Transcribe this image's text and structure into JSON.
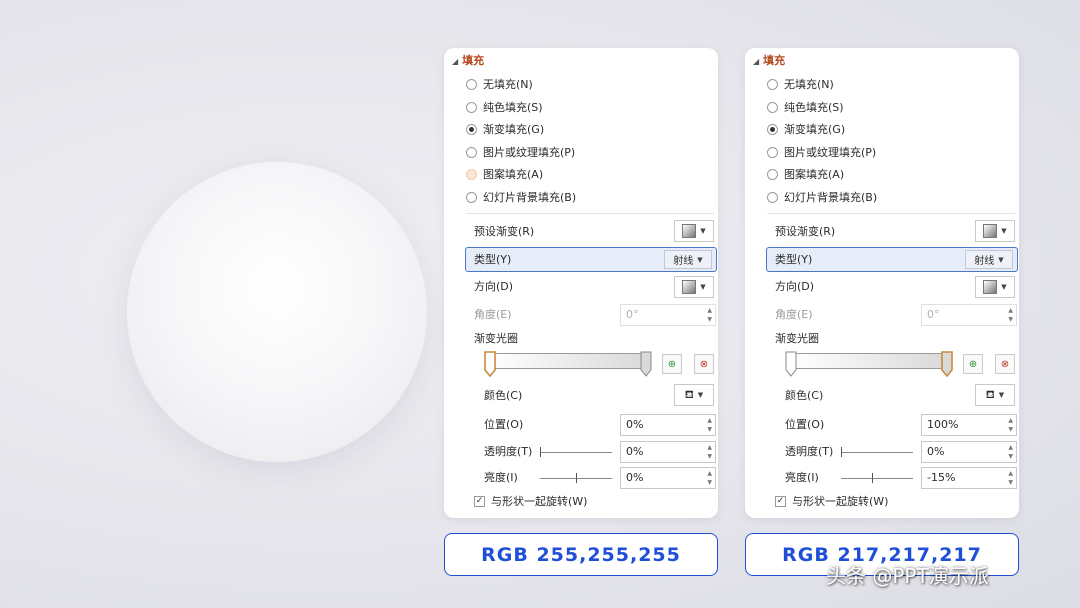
{
  "panels": [
    {
      "section_title": "填充",
      "fill_options": [
        {
          "label": "无填充(N)",
          "state": "unchecked"
        },
        {
          "label": "纯色填充(S)",
          "state": "unchecked"
        },
        {
          "label": "渐变填充(G)",
          "state": "checked"
        },
        {
          "label": "图片或纹理填充(P)",
          "state": "unchecked"
        },
        {
          "label": "图案填充(A)",
          "state": "hover"
        },
        {
          "label": "幻灯片背景填充(B)",
          "state": "unchecked"
        }
      ],
      "preset_label": "预设渐变(R)",
      "type_label": "类型(Y)",
      "type_value": "射线",
      "direction_label": "方向(D)",
      "angle_label": "角度(E)",
      "angle_value": "0°",
      "stops_label": "渐变光圈",
      "active_stop": "left",
      "color_label": "颜色(C)",
      "position_label": "位置(O)",
      "position_value": "0%",
      "transparency_label": "透明度(T)",
      "transparency_value": "0%",
      "brightness_label": "亮度(I)",
      "brightness_value": "0%",
      "rotate_label": "与形状一起旋转(W)",
      "rotate_checked": true,
      "rgb_text": "RGB 255,255,255"
    },
    {
      "section_title": "填充",
      "fill_options": [
        {
          "label": "无填充(N)",
          "state": "unchecked"
        },
        {
          "label": "纯色填充(S)",
          "state": "unchecked"
        },
        {
          "label": "渐变填充(G)",
          "state": "checked"
        },
        {
          "label": "图片或纹理填充(P)",
          "state": "unchecked"
        },
        {
          "label": "图案填充(A)",
          "state": "unchecked"
        },
        {
          "label": "幻灯片背景填充(B)",
          "state": "unchecked"
        }
      ],
      "preset_label": "预设渐变(R)",
      "type_label": "类型(Y)",
      "type_value": "射线",
      "direction_label": "方向(D)",
      "angle_label": "角度(E)",
      "angle_value": "0°",
      "stops_label": "渐变光圈",
      "active_stop": "right",
      "color_label": "颜色(C)",
      "position_label": "位置(O)",
      "position_value": "100%",
      "transparency_label": "透明度(T)",
      "transparency_value": "0%",
      "brightness_label": "亮度(I)",
      "brightness_value": "-15%",
      "rotate_label": "与形状一起旋转(W)",
      "rotate_checked": true,
      "rgb_text": "RGB 217,217,217"
    }
  ],
  "watermark": "头条 @PPT演示派",
  "colors": {
    "accent_blue": "#1f4fd8",
    "section_title": "#b5471f",
    "active_stop": "#c98a3c"
  }
}
